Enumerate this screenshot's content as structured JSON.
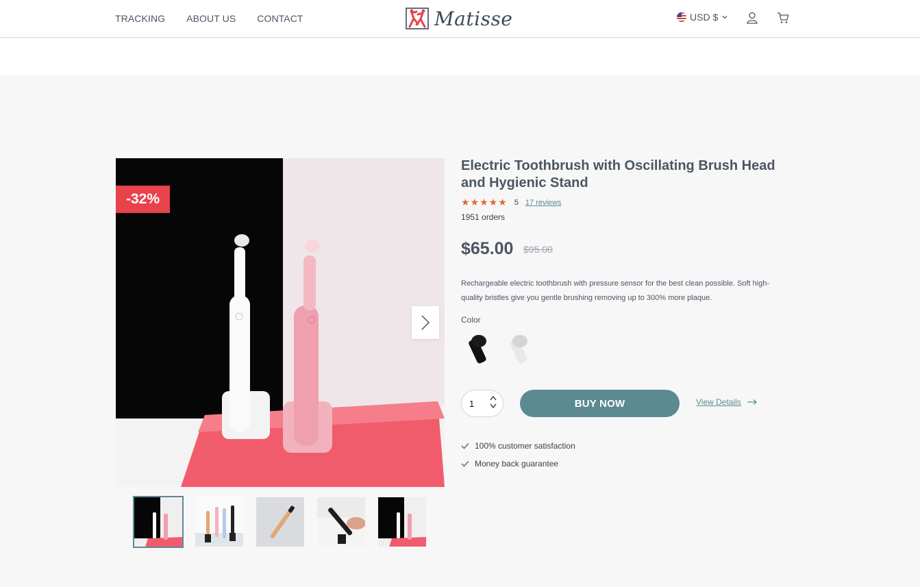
{
  "header": {
    "nav": [
      "TRACKING",
      "ABOUT US",
      "CONTACT"
    ],
    "logo_text": "Matisse",
    "currency": "USD $"
  },
  "gallery": {
    "discount_badge": "-32%",
    "thumbnail_count": 5,
    "active_thumbnail": 1
  },
  "product": {
    "title": "Electric Toothbrush with Oscillating Brush Head and Hygienic Stand",
    "rating_value": "5",
    "stars": 5,
    "reviews_link": "17 reviews",
    "orders": "1951 orders",
    "price": "$65.00",
    "compare_price": "$95.00",
    "description": "Rechargeable electric toothbrush with pressure sensor for the best clean possible. Soft high-quality bristles give you gentle brushing removing up to 300% more plaque.",
    "color_label": "Color",
    "color_options": [
      "black-brush-head-icon",
      "white-brush-head-icon"
    ],
    "quantity": "1",
    "buy_label": "BUY NOW",
    "details_label": "View Details",
    "features": [
      "100% customer satisfaction",
      "Money back guarantee"
    ]
  },
  "colors": {
    "accent": "#5b8a93",
    "badge": "#e8424b",
    "stars": "#e26a32"
  }
}
